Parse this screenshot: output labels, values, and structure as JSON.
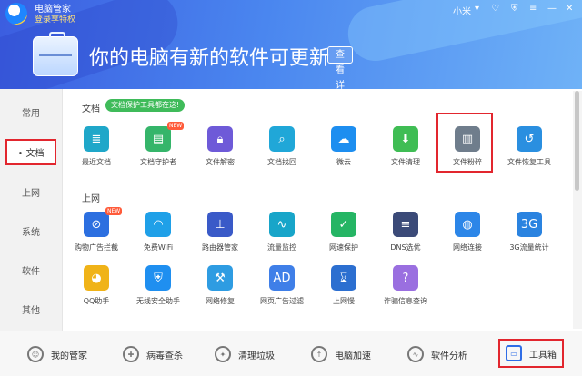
{
  "app": {
    "name": "电脑管家",
    "privilege_link": "登录享特权",
    "user_label": "小米"
  },
  "hero": {
    "title": "你的电脑有新的软件可更新",
    "detail_button": "查看详情"
  },
  "sidebar": {
    "items": [
      "常用",
      "文档",
      "上网",
      "系统",
      "软件",
      "其他"
    ],
    "active": "文档"
  },
  "sections": {
    "doc": {
      "title": "文档",
      "badge": "文档保护工具都在这!",
      "tiles": [
        {
          "label": "最近文档",
          "icon": "recent-docs-icon",
          "color": "#1fa7c9"
        },
        {
          "label": "文档守护者",
          "icon": "doc-guard-icon",
          "color": "#35b56a",
          "new": "NEW"
        },
        {
          "label": "文件解密",
          "icon": "folder-lock-icon",
          "color": "#6e5ad8"
        },
        {
          "label": "文档找回",
          "icon": "doc-search-icon",
          "color": "#20a7d8"
        },
        {
          "label": "微云",
          "icon": "cloud-icon",
          "color": "#1d8ef0"
        },
        {
          "label": "文件清理",
          "icon": "file-clean-icon",
          "color": "#3fbd54"
        },
        {
          "label": "文件粉碎",
          "icon": "shredder-icon",
          "color": "#6f7d8c"
        },
        {
          "label": "文件恢复工具",
          "icon": "file-restore-icon",
          "color": "#2a8fe0"
        }
      ]
    },
    "web": {
      "title": "上网",
      "tiles": [
        {
          "label": "购物广告拦截",
          "icon": "ad-block-icon",
          "color": "#2c6fe0",
          "new": "NEW"
        },
        {
          "label": "免费WiFi",
          "icon": "wifi-icon",
          "color": "#1fa0e8"
        },
        {
          "label": "路由器管家",
          "icon": "router-icon",
          "color": "#3a5ac8"
        },
        {
          "label": "流量监控",
          "icon": "traffic-monitor-icon",
          "color": "#18a5c9"
        },
        {
          "label": "网速保护",
          "icon": "speed-shield-icon",
          "color": "#25b564"
        },
        {
          "label": "DNS选优",
          "icon": "dns-icon",
          "color": "#3b4a78"
        },
        {
          "label": "网络连接",
          "icon": "globe-icon",
          "color": "#2c86e8"
        },
        {
          "label": "3G流量统计",
          "icon": "3g-icon",
          "color": "#2a83e0"
        }
      ]
    },
    "more": {
      "tiles": [
        {
          "label": "QQ助手",
          "icon": "qq-icon",
          "color": "#f0b318"
        },
        {
          "label": "无线安全助手",
          "icon": "wifi-shield-icon",
          "color": "#1f8ff0"
        },
        {
          "label": "网络修复",
          "icon": "network-repair-icon",
          "color": "#2e9ce2"
        },
        {
          "label": "网页广告过滤",
          "icon": "ad-filter-icon",
          "color": "#3f7fe8"
        },
        {
          "label": "上网慢",
          "icon": "hourglass-icon",
          "color": "#2c6fd0"
        },
        {
          "label": "诈骗信息查询",
          "icon": "fraud-query-icon",
          "color": "#9a6fe0"
        }
      ]
    }
  },
  "bottom_nav": [
    {
      "label": "我的管家",
      "icon": "butler-icon"
    },
    {
      "label": "病毒查杀",
      "icon": "virus-scan-icon"
    },
    {
      "label": "清理垃圾",
      "icon": "clean-junk-icon"
    },
    {
      "label": "电脑加速",
      "icon": "rocket-icon"
    },
    {
      "label": "软件分析",
      "icon": "software-analysis-icon"
    },
    {
      "label": "工具箱",
      "icon": "toolbox-icon"
    }
  ],
  "colors": {
    "accent": "#2f6de6",
    "highlight": "#e2262e",
    "badge": "#3fbb5a"
  }
}
